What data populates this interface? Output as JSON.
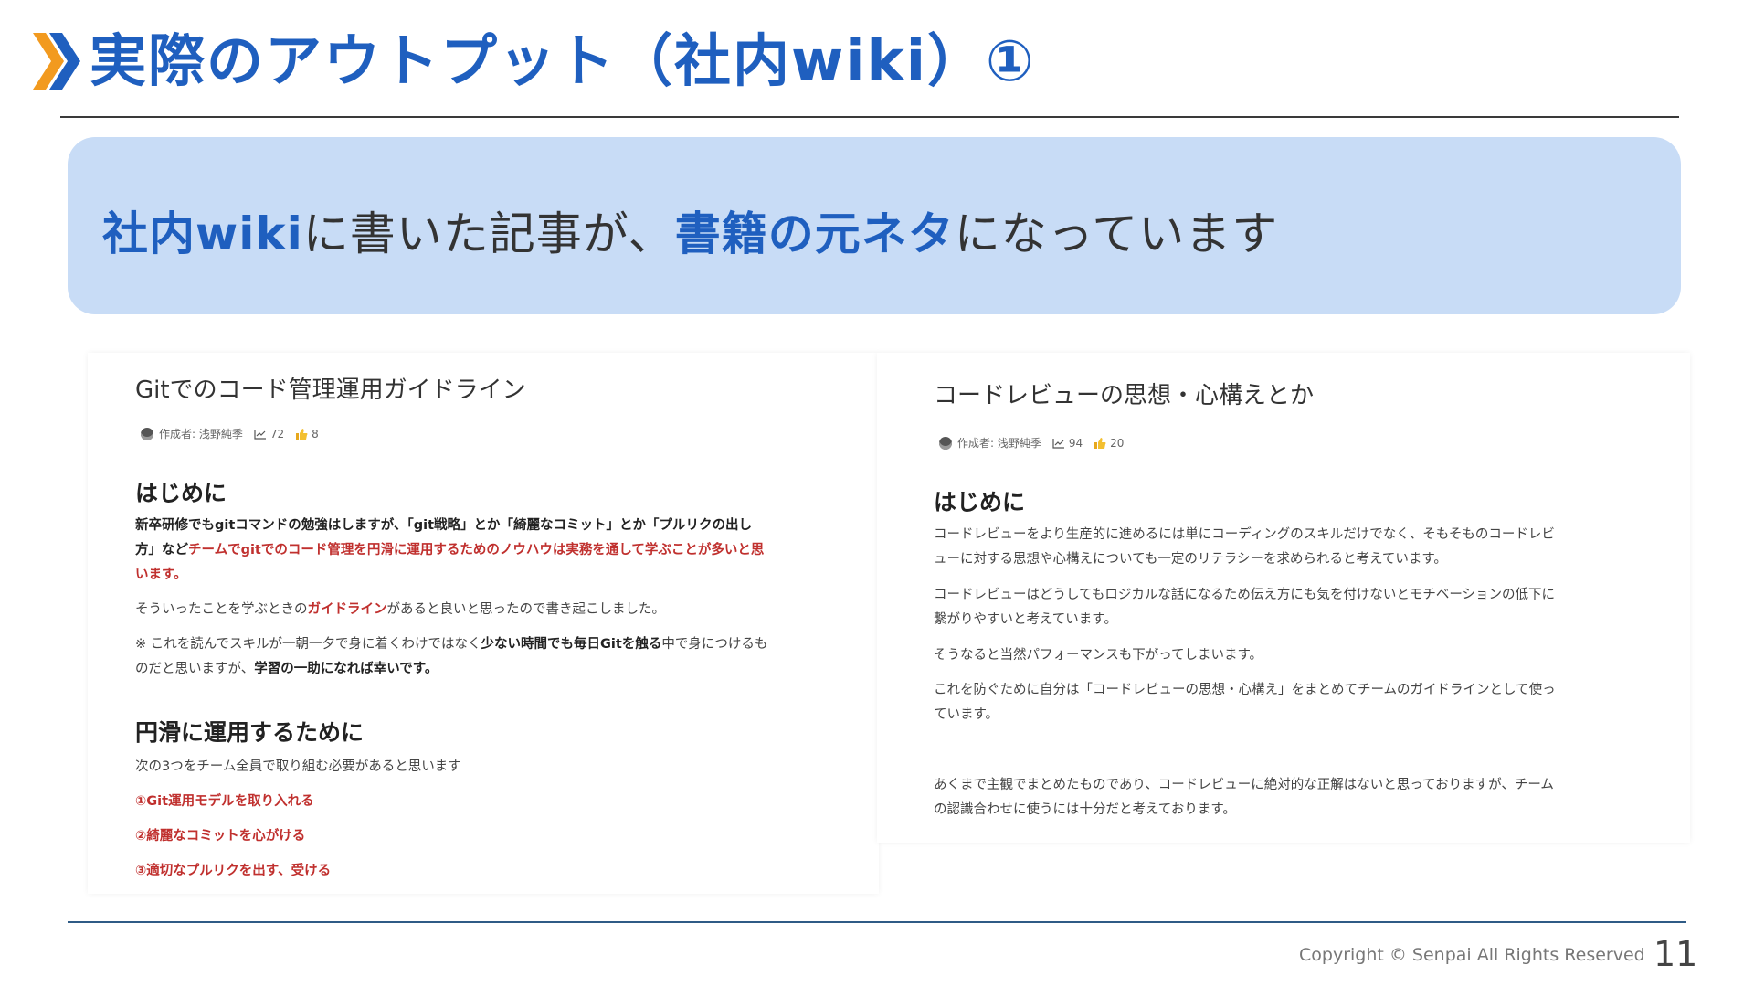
{
  "slide": {
    "title": "実際のアウトプット（社内wiki）①",
    "callout": {
      "part1": "社内wiki",
      "part2": "に書いた記事が、",
      "part3": "書籍の元ネタ",
      "part4": "になっています"
    },
    "footer": {
      "copyright": "Copyright © Senpai All Rights Reserved",
      "page": "11"
    }
  },
  "left_doc": {
    "title": "Gitでのコード管理運用ガイドライン",
    "author": "作成者: 浅野純季",
    "views": "72",
    "likes": "8",
    "section1_heading": "はじめに",
    "p1_line1": "新卒研修でもgitコマンドの勉強はしますが、「git戦略」とか「綺麗なコミット」とか「プルリクの出し",
    "p1_line2_a": "方」など",
    "p1_line2_b": "チームでgitでのコード管理を円滑に運用するためのノウハウは実務を通して学ぶことが多いと思",
    "p1_line3": "います。",
    "p2_a": "そういったことを学ぶときの",
    "p2_b": "ガイドライン",
    "p2_c": "があると良いと思ったので書き起こしました。",
    "p3_line1_a": "※ これを読んでスキルが一朝一夕で身に着くわけではなく",
    "p3_line1_b": "少ない時間でも毎日Gitを触る",
    "p3_line1_c": "中で身につけるも",
    "p3_line2_a": "のだと思いますが、",
    "p3_line2_b": "学習の一助になれば幸いです。",
    "section2_heading": "円滑に運用するために",
    "p4": "次の3つをチーム全員で取り組む必要があると思います",
    "items": [
      "①Git運用モデルを取り入れる",
      "②綺麗なコミットを心がける",
      "③適切なプルリクを出す、受ける"
    ]
  },
  "right_doc": {
    "title": "コードレビューの思想・心構えとか",
    "author": "作成者: 浅野純季",
    "views": "94",
    "likes": "20",
    "section1_heading": "はじめに",
    "p1_line1": "コードレビューをより生産的に進めるには単にコーディングのスキルだけでなく、そもそものコードレビ",
    "p1_line2": "ューに対する思想や心構えについても一定のリテラシーを求められると考えています。",
    "p2_line1": "コードレビューはどうしてもロジカルな話になるため伝え方にも気を付けないとモチベーションの低下に",
    "p2_line2": "繋がりやすいと考えています。",
    "p3": "そうなると当然パフォーマンスも下がってしまいます。",
    "p4_line1": "これを防ぐために自分は「コードレビューの思想・心構え」をまとめてチームのガイドラインとして使っ",
    "p4_line2": "ています。",
    "p5_line1": "あくまで主観でまとめたものであり、コードレビューに絶対的な正解はないと思っておりますが、チーム",
    "p5_line2": "の認識合わせに使うには十分だと考えております。"
  },
  "colors": {
    "accent_blue": "#1f5fbf",
    "callout_bg": "#c8dcf6",
    "chevron_orange": "#f29a1f",
    "emphasis_red": "#c0302e"
  }
}
